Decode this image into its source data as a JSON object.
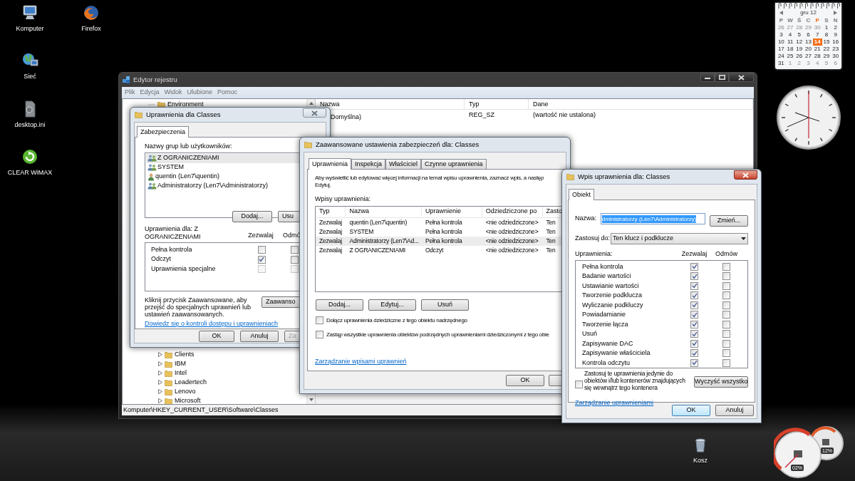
{
  "desktop_icons": [
    {
      "label": "Komputer",
      "kind": "computer"
    },
    {
      "label": "Firefox",
      "kind": "browser"
    },
    {
      "label": "Sieć",
      "kind": "network"
    },
    {
      "label": "desktop.ini",
      "kind": "file"
    },
    {
      "label": "CLEAR WiMAX",
      "kind": "wimax"
    },
    {
      "label": "Kosz",
      "kind": "trash"
    }
  ],
  "calendar": {
    "month": "gru 12",
    "weekdays": [
      {
        "label": "P",
        "selected": false
      },
      {
        "label": "W",
        "selected": false
      },
      {
        "label": "Ś",
        "selected": false
      },
      {
        "label": "C",
        "selected": false
      },
      {
        "label": "P",
        "selected": true
      },
      {
        "label": "S",
        "selected": false
      },
      {
        "label": "N",
        "selected": false
      }
    ],
    "weeks": [
      [
        {
          "day": "26",
          "muted": true,
          "selected": false
        },
        {
          "day": "27",
          "muted": true,
          "selected": false
        },
        {
          "day": "28",
          "muted": true,
          "selected": false
        },
        {
          "day": "29",
          "muted": true,
          "selected": false
        },
        {
          "day": "30",
          "muted": true,
          "selected": false
        },
        {
          "day": "1",
          "muted": false,
          "selected": false
        },
        {
          "day": "2",
          "muted": false,
          "selected": false
        }
      ],
      [
        {
          "day": "3",
          "muted": false,
          "selected": false
        },
        {
          "day": "4",
          "muted": false,
          "selected": false
        },
        {
          "day": "5",
          "muted": false,
          "selected": false
        },
        {
          "day": "6",
          "muted": false,
          "selected": false
        },
        {
          "day": "7",
          "muted": false,
          "selected": false
        },
        {
          "day": "8",
          "muted": false,
          "selected": false
        },
        {
          "day": "9",
          "muted": false,
          "selected": false
        }
      ],
      [
        {
          "day": "10",
          "muted": false,
          "selected": false
        },
        {
          "day": "11",
          "muted": false,
          "selected": false
        },
        {
          "day": "12",
          "muted": false,
          "selected": false
        },
        {
          "day": "13",
          "muted": false,
          "selected": false
        },
        {
          "day": "14",
          "muted": false,
          "selected": true
        },
        {
          "day": "15",
          "muted": false,
          "selected": false
        },
        {
          "day": "16",
          "muted": false,
          "selected": false
        }
      ],
      [
        {
          "day": "17",
          "muted": false,
          "selected": false
        },
        {
          "day": "18",
          "muted": false,
          "selected": false
        },
        {
          "day": "19",
          "muted": false,
          "selected": false
        },
        {
          "day": "20",
          "muted": false,
          "selected": false
        },
        {
          "day": "21",
          "muted": false,
          "selected": false
        },
        {
          "day": "22",
          "muted": false,
          "selected": false
        },
        {
          "day": "23",
          "muted": false,
          "selected": false
        }
      ],
      [
        {
          "day": "24",
          "muted": false,
          "selected": false
        },
        {
          "day": "25",
          "muted": false,
          "selected": false
        },
        {
          "day": "26",
          "muted": false,
          "selected": false
        },
        {
          "day": "27",
          "muted": false,
          "selected": false
        },
        {
          "day": "28",
          "muted": false,
          "selected": false
        },
        {
          "day": "29",
          "muted": false,
          "selected": false
        },
        {
          "day": "30",
          "muted": false,
          "selected": false
        }
      ],
      [
        {
          "day": "31",
          "muted": false,
          "selected": false
        },
        {
          "day": "1",
          "muted": true,
          "selected": false
        },
        {
          "day": "2",
          "muted": true,
          "selected": false
        },
        {
          "day": "3",
          "muted": true,
          "selected": false
        },
        {
          "day": "4",
          "muted": true,
          "selected": false
        },
        {
          "day": "5",
          "muted": true,
          "selected": false
        },
        {
          "day": "6",
          "muted": true,
          "selected": false
        }
      ]
    ]
  },
  "meter": {
    "readings": [
      "02%",
      "12%"
    ]
  },
  "registry": {
    "title": "Edytor rejestru",
    "menu": [
      "Plik",
      "Edycja",
      "Widok",
      "Ulubione",
      "Pomoc"
    ],
    "tree": {
      "top_items": [
        {
          "label": "Environment",
          "expandable": false
        }
      ],
      "bottom_items": [
        {
          "label": "Clients",
          "expandable": true
        },
        {
          "label": "IBM",
          "expandable": true
        },
        {
          "label": "Intel",
          "expandable": true
        },
        {
          "label": "Leadertech",
          "expandable": true
        },
        {
          "label": "Lenovo",
          "expandable": true
        },
        {
          "label": "Microsoft",
          "expandable": true
        }
      ]
    },
    "columns": [
      "Nazwa",
      "Typ",
      "Dane"
    ],
    "rows": [
      {
        "name": "Domyślna)",
        "type": "REG_SZ",
        "data": "(wartość nie ustalona)"
      }
    ],
    "status_bar": "Komputer\\HKEY_CURRENT_USER\\Software\\Classes"
  },
  "permissions_dialog": {
    "title": "Uprawnienia dla Classes",
    "tabs": [
      {
        "label": "Zabezpieczenia",
        "selected": true
      }
    ],
    "users_label": "Nazwy grup lub użytkowników:",
    "users": [
      {
        "name": "Z OGRANICZENIAMI",
        "kind": "group",
        "selected": true
      },
      {
        "name": "SYSTEM",
        "kind": "group",
        "selected": false
      },
      {
        "name": "quentin (Len7\\quentin)",
        "kind": "user",
        "selected": false
      },
      {
        "name": "Administratorzy (Len7\\Administratorzy)",
        "kind": "group",
        "selected": false
      }
    ],
    "user_buttons": [
      "Dodaj...",
      "Usu"
    ],
    "permissions_label": "Uprawnienia dla: Z OGRANICZENIAMI",
    "allow_header": "Zezwalaj",
    "deny_header": "Odmó",
    "permissions": [
      {
        "name": "Pełna kontrola",
        "allow": false,
        "deny": false,
        "disabled": false
      },
      {
        "name": "Odczyt",
        "allow": true,
        "deny": false,
        "disabled": false
      },
      {
        "name": "Uprawnienia specjalne",
        "allow": false,
        "deny": false,
        "disabled": true
      }
    ],
    "advanced_note": "Kliknij przycisk Zaawansowane, aby przejść do specjalnych uprawnień lub ustawień zaawansowanych.",
    "advanced_button": "Zaawanso",
    "link": "Dowiedz się o kontroli dostępu i uprawnieniach",
    "footer_buttons": [
      {
        "label": "OK",
        "disabled": false
      },
      {
        "label": "Anuluj",
        "disabled": false
      },
      {
        "label": "Za",
        "disabled": true
      }
    ]
  },
  "advanced_dialog": {
    "title": "Zaawansowane ustawienia zabezpieczeń dla: Classes",
    "tabs": [
      {
        "label": "Uprawnienia",
        "selected": true
      },
      {
        "label": "Inspekcja",
        "selected": false
      },
      {
        "label": "Właściciel",
        "selected": false
      },
      {
        "label": "Czynne uprawnienia",
        "selected": false
      }
    ],
    "info_lines": [
      "Aby wyświetlić lub edytować więcej informacji na temat wpisu uprawnienia, zaznacz wpis, a następ",
      "Edytuj."
    ],
    "entries_label": "Wpisy uprawnienia:",
    "columns": [
      "Typ",
      "Nazwa",
      "Uprawnienie",
      "Odziedziczone po",
      "Zasto"
    ],
    "rows": [
      {
        "cells": [
          "Zezwalaj",
          "quentin (Len7\\quentin)",
          "Pełna kontrola",
          "<nie odziedziczone>",
          "Ten"
        ],
        "selected": false
      },
      {
        "cells": [
          "Zezwalaj",
          "SYSTEM",
          "Pełna kontrola",
          "<nie odziedziczone>",
          "Ten"
        ],
        "selected": false
      },
      {
        "cells": [
          "Zezwalaj",
          "Administratorzy (Len7\\Ad...",
          "Pełna kontrola",
          "<nie odziedziczone>",
          "Ten"
        ],
        "selected": true
      },
      {
        "cells": [
          "Zezwalaj",
          "Z OGRANICZENIAMI",
          "Odczyt",
          "<nie odziedziczone>",
          "Ten"
        ],
        "selected": false
      }
    ],
    "buttons": [
      "Dodaj...",
      "Edytuj...",
      "Usuń"
    ],
    "options": [
      {
        "label": "Dołącz uprawnienia dziedziczne z tego obiektu nadrzędnego",
        "checked": false
      },
      {
        "label": "Zastąp wszystkie uprawnienia obiektów podrzędnych uprawnieniami dziedziczonymi z tego obie",
        "checked": false
      }
    ],
    "link": "Zarządzanie wpisami uprawnień",
    "footer_button": "OK"
  },
  "entry_dialog": {
    "title": "Wpis uprawnienia dla: Classes",
    "tabs": [
      {
        "label": "Obiekt",
        "selected": true
      }
    ],
    "name_label": "Nazwa:",
    "name_field": {
      "value": "dministratorzy (Len7\\Administratorzy)",
      "selected": true
    },
    "change_button": "Zmień...",
    "apply_label": "Zastosuj do:",
    "apply_value": "Ten klucz i podklucze",
    "permissions_label": "Uprawnienia:",
    "allow_header": "Zezwalaj",
    "deny_header": "Odmów",
    "permissions": [
      {
        "name": "Pełna kontrola",
        "allow": true,
        "deny": false
      },
      {
        "name": "Badanie wartości",
        "allow": true,
        "deny": false
      },
      {
        "name": "Ustawianie wartości",
        "allow": true,
        "deny": false
      },
      {
        "name": "Tworzenie podklucza",
        "allow": true,
        "deny": false
      },
      {
        "name": "Wyliczanie podkluczy",
        "allow": true,
        "deny": false
      },
      {
        "name": "Powiadamianie",
        "allow": true,
        "deny": false
      },
      {
        "name": "Tworzenie łącza",
        "allow": true,
        "deny": false
      },
      {
        "name": "Usuń",
        "allow": true,
        "deny": false
      },
      {
        "name": "Zapisywanie DAC",
        "allow": true,
        "deny": false
      },
      {
        "name": "Zapisywanie właściciela",
        "allow": true,
        "deny": false
      },
      {
        "name": "Kontrola odczytu",
        "allow": true,
        "deny": false
      }
    ],
    "inherit_option": {
      "label": "Zastosuj te uprawnienia jedynie do obiektów i/lub kontenerów znajdujących się wewnątrz tego kontenera",
      "checked": false
    },
    "clear_button": "Wyczyść wszystko",
    "link": "Zarządzanie uprawnieniami",
    "footer_buttons": [
      {
        "label": "OK",
        "default": true
      },
      {
        "label": "Anuluj",
        "default": false
      }
    ]
  }
}
